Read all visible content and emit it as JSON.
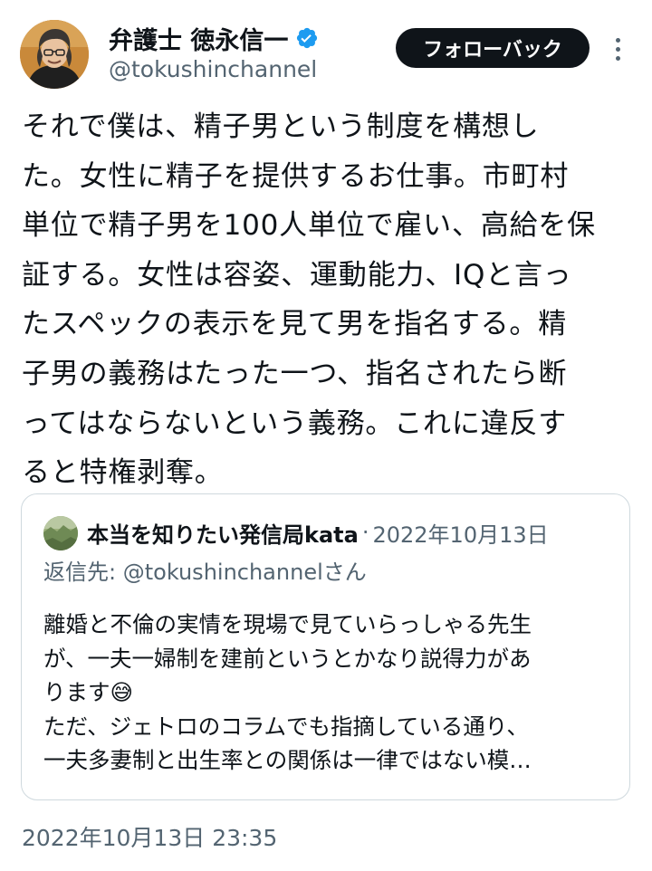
{
  "author": {
    "display_name": "弁護士 徳永信一",
    "handle": "@tokushinchannel",
    "verified": true,
    "avatar_icon": "profile-photo-icon"
  },
  "actions": {
    "follow_back_label": "フォローバック",
    "more_icon": "more-vertical-icon"
  },
  "tweet": {
    "text": "それで僕は、精子男という制度を構想し\nた。女性に精子を提供するお仕事。市町村\n単位で精子男を100人単位で雇い、高給を保\n証する。女性は容姿、運動能力、IQと言っ\nたスペックの表示を見て男を指名する。精\n子男の義務はたった一つ、指名されたら断\nってはならないという義務。これに違反す\nると特権剥奪。",
    "timestamp": "2022年10月13日 23:35"
  },
  "quote": {
    "author_name": "本当を知りたい発信局kata",
    "separator": "·",
    "date": "2022年10月13日",
    "reply_prefix": "返信先: ",
    "reply_mention": "@tokushinchannel",
    "reply_suffix": "さん",
    "text": "離婚と不倫の実情を現場で見ていらっしゃる先生\nが、一夫一婦制を建前というとかなり説得力があ\nります😅\nただ、ジェトロのコラムでも指摘している通り、\n一夫多妻制と出生率との関係は一律ではない模…"
  },
  "colors": {
    "text_primary": "#0f1419",
    "text_secondary": "#536471",
    "border": "#cfd9de",
    "verified_blue": "#1d9bf0",
    "button_bg": "#0f1419",
    "button_text": "#ffffff"
  }
}
